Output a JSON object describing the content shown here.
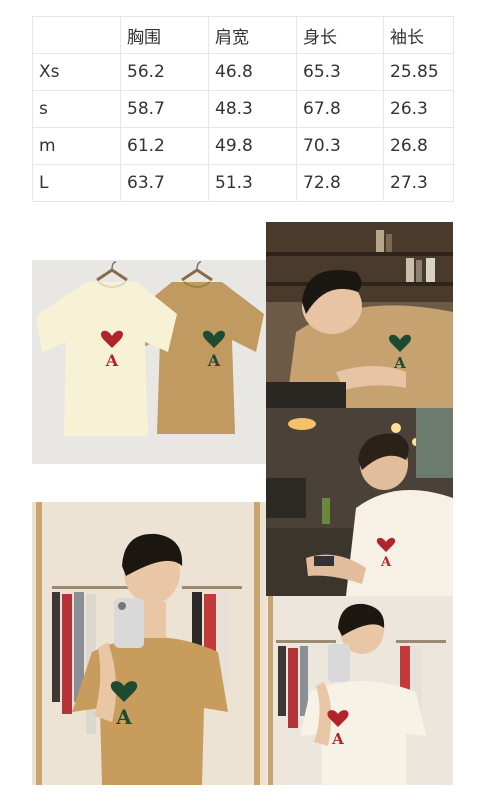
{
  "size_table": {
    "headers": [
      "",
      "胸围",
      "肩宽",
      "身长",
      "袖长"
    ],
    "rows": [
      [
        "Xs",
        "56.2",
        "46.8",
        "65.3",
        "25.85"
      ],
      [
        "s",
        "58.7",
        "48.3",
        "67.8",
        "26.3"
      ],
      [
        "m",
        "61.2",
        "49.8",
        "70.3",
        "26.8"
      ],
      [
        "L",
        "63.7",
        "51.3",
        "72.8",
        "27.3"
      ]
    ]
  },
  "photos": [
    {
      "id": "product-flatlay",
      "shirt_colors": [
        "#f7f1d6",
        "#c09a60"
      ],
      "logo_colors": [
        "#b2242c",
        "#1e4a30"
      ]
    },
    {
      "id": "model-reclining",
      "shirt_color": "#c5a270",
      "logo_color": "#1e4a30"
    },
    {
      "id": "model-cafe",
      "shirt_color": "#f6f1e4",
      "logo_color": "#b2242c"
    },
    {
      "id": "model-mirror-tan",
      "shirt_color": "#c89c5c",
      "logo_color": "#1e4a30"
    },
    {
      "id": "model-mirror-cream",
      "shirt_color": "#f7f2e6",
      "logo_color": "#b2242c"
    }
  ]
}
